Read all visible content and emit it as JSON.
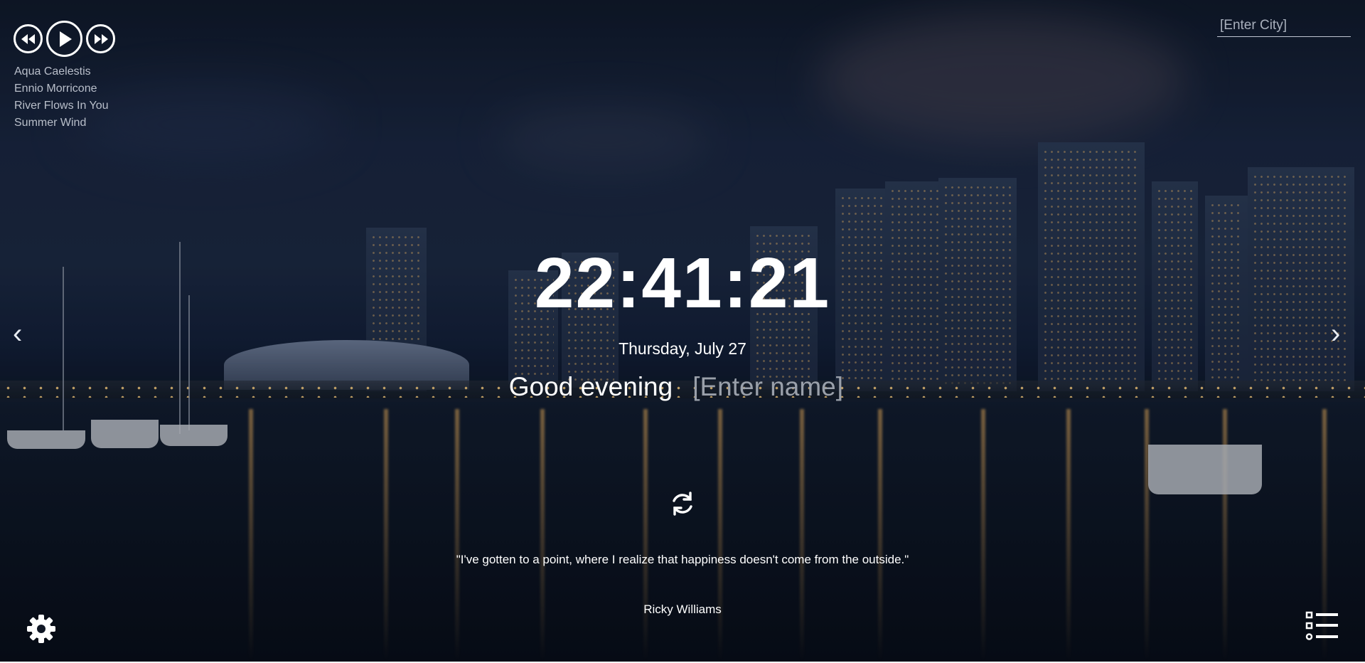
{
  "player": {
    "prev_icon": "rewind-icon",
    "play_icon": "play-icon",
    "next_icon": "fast-forward-icon",
    "playlist": [
      "Aqua Caelestis",
      "Ennio Morricone",
      "River Flows In You",
      "Summer Wind"
    ]
  },
  "weather": {
    "city_placeholder": "[Enter City]"
  },
  "clock": {
    "time": "22:41:21",
    "date": "Thursday, July 27"
  },
  "greeting": {
    "text": "Good evening",
    "name_placeholder": "[Enter name]"
  },
  "nav": {
    "prev_icon": "chevron-left-icon",
    "next_icon": "chevron-right-icon",
    "prev": "‹",
    "next": "›"
  },
  "quote": {
    "refresh_icon": "refresh-icon",
    "text": "\"I've gotten to a point, where I realize that happiness doesn't come from the outside.\"",
    "author": "Ricky Williams"
  },
  "footer": {
    "settings_icon": "gear-icon",
    "todo_icon": "todo-list-icon"
  },
  "colors": {
    "text": "#ffffff",
    "muted": "#b9bfca",
    "placeholder": "#9aa0aa"
  }
}
